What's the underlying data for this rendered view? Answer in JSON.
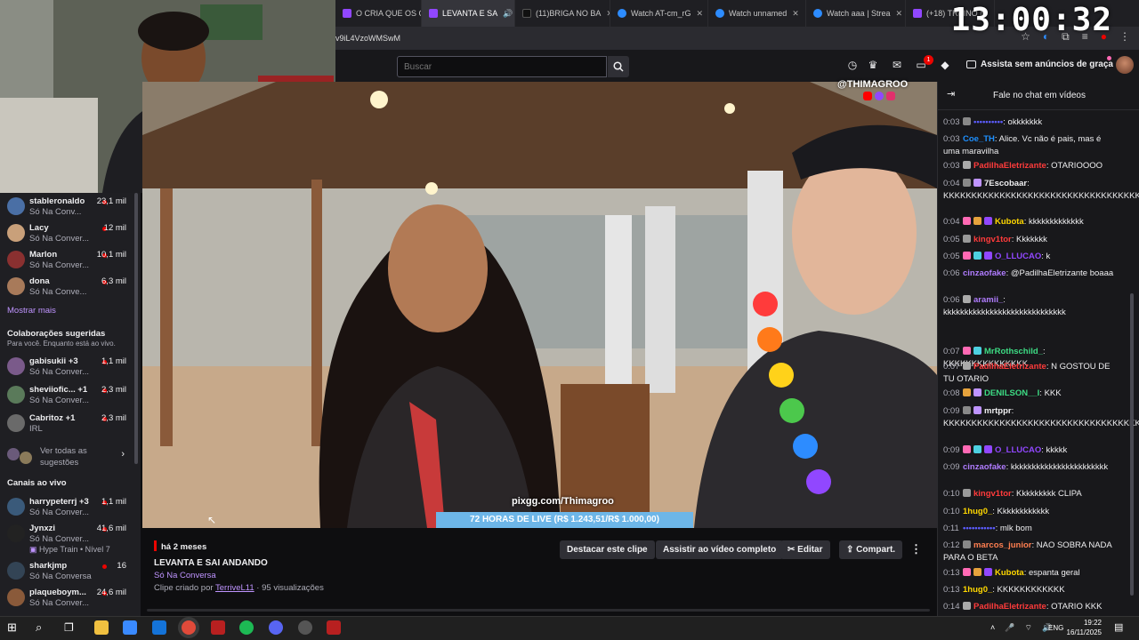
{
  "browser": {
    "tabs": [
      {
        "title": "O CRIA QUE OS C",
        "color": "#9147ff"
      },
      {
        "title": "LEVANTA E SA",
        "color": "#9147ff",
        "active": true
      },
      {
        "title": "(11)BRIGA NO BA",
        "color": "#111111"
      },
      {
        "title": "Watch AT-cm_rG",
        "color": "#2d8cff"
      },
      {
        "title": "Watch unnamed",
        "color": "#2d8cff"
      },
      {
        "title": "Watch aaa | Strea",
        "color": "#2d8cff"
      },
      {
        "title": "(+18) TREINO N",
        "color": "#9147ff"
      }
    ],
    "url_fragment": "v9iL4VzoWMSwM",
    "clock": "13:00:32"
  },
  "topnav": {
    "search_placeholder": "Buscar",
    "notification_count": "1",
    "adfree_label": "Assista sem anúncios de graça"
  },
  "sidebar": {
    "followed": [
      {
        "name": "stableronaldo",
        "sub": "Só Na Conv...",
        "viewers": "23,1 mil",
        "color": "#4a6fa5"
      },
      {
        "name": "Lacy",
        "sub": "Só Na Conver...",
        "viewers": "12 mil",
        "color": "#c9a07a"
      },
      {
        "name": "Marlon",
        "sub": "Só Na Conver...",
        "viewers": "10,1 mil",
        "color": "#8a3030"
      },
      {
        "name": "dona",
        "sub": "Só Na Conve...",
        "viewers": "6,3 mil",
        "color": "#a87a5a"
      }
    ],
    "show_more": "Mostrar mais",
    "collab_title": "Colaborações sugeridas",
    "collab_sub": "Para você. Enquanto está ao vivo.",
    "collabs": [
      {
        "name": "gabisukii +3",
        "sub": "Só Na Conver...",
        "viewers": "1,1 mil",
        "color": "#7a5a8a"
      },
      {
        "name": "sheviiofic... +1",
        "sub": "Só Na Conver...",
        "viewers": "2,3 mil",
        "color": "#5a7a5a"
      },
      {
        "name": "Cabritoz +1",
        "sub": "IRL",
        "viewers": "2,3 mil",
        "color": "#6a6a6a"
      }
    ],
    "see_all": "Ver todas as sugestões",
    "live_title": "Canais ao vivo",
    "live": [
      {
        "name": "harrypeterrj +3",
        "sub": "Só Na Conver...",
        "viewers": "1,1 mil",
        "color": "#3a5a7a"
      },
      {
        "name": "Jynxzi",
        "sub": "Só Na Conver...",
        "viewers": "41,6 mil",
        "color": "#222222"
      },
      {
        "name": "Hype Train • Nível 7",
        "sub": "",
        "viewers": "",
        "color": ""
      },
      {
        "name": "sharkjmp",
        "sub": "Só Na Conversa",
        "viewers": "16",
        "color": "#334455"
      },
      {
        "name": "plaqueboym...",
        "sub": "Só Na Conver...",
        "viewers": "24,6 mil",
        "color": "#8a5a3a"
      }
    ]
  },
  "video": {
    "watermark": "@THIMAGROO",
    "pix": "pixgg.com/Thimagroo",
    "goal_text": "72 HORAS DE LIVE (R$ 1.243,51/R$ 1.000,00)"
  },
  "clip": {
    "ago": "há 2 meses",
    "title": "LEVANTA E SAI ANDANDO",
    "category": "Só Na Conversa",
    "created_prefix": "Clipe criado por",
    "creator": "TerriveL11",
    "views": " · 95 visualizações",
    "buttons": {
      "highlight": "Destacar este clipe",
      "watch_full": "Assistir ao vídeo completo",
      "edit": "Editar",
      "share": "Compart."
    }
  },
  "chat": {
    "title": "Fale no chat em vídeos",
    "messages": [
      {
        "ts": "0:03",
        "user": "••••••••••",
        "color": "#5c5cff",
        "badges": [
          "#888"
        ],
        "text": ": okkkkkkk"
      },
      {
        "ts": "0:03",
        "user": "Coe_TH",
        "color": "#1e90ff",
        "badges": [],
        "text": ": Alice. Vc não é pais, mas é uma maravilha"
      },
      {
        "ts": "0:03",
        "user": "PadilhaEletrizante",
        "color": "#ff3b3b",
        "badges": [
          "#aaa"
        ],
        "text": ": OTARIOOOO"
      },
      {
        "ts": "0:04",
        "user": "7Escobaar",
        "color": "#efeff1",
        "badges": [
          "#888",
          "#bf94ff"
        ],
        "text": ": KKKKKKKKKKKKKKKKKKKKKKKKKKKKKKKKKKKKK"
      },
      {
        "ts": "0:04",
        "user": "Kubota",
        "color": "#ffd700",
        "badges": [
          "#ff69b4",
          "#e6a23c",
          "#9147ff"
        ],
        "text": ": kkkkkkkkkkkkk"
      },
      {
        "ts": "0:05",
        "user": "kingv1tor",
        "color": "#ff3b3b",
        "badges": [
          "#999"
        ],
        "text": ": Kkkkkkk"
      },
      {
        "ts": "0:05",
        "user": "O_LLUCAO",
        "color": "#9147ff",
        "badges": [
          "#ff69b4",
          "#4dd0e1",
          "#9147ff"
        ],
        "text": ": k"
      },
      {
        "ts": "0:06",
        "user": "cinzaofake",
        "color": "#b07cff",
        "badges": [],
        "text": ": @PadilhaEletrizante boaaa"
      },
      {
        "ts": "0:06",
        "user": "aramii_",
        "color": "#b07cff",
        "badges": [
          "#aaa"
        ],
        "text": ": kkkkkkkkkkkkkkkkkkkkkkkkkkkkk"
      },
      {
        "ts": "0:07",
        "user": "MrRothschild_",
        "color": "#3ddc84",
        "badges": [
          "#ff69b4",
          "#4dd0e1"
        ],
        "text": ": KKKKKKKKKKKKKKK"
      },
      {
        "ts": "0:07",
        "user": "PadilhaEletrizante",
        "color": "#ff3b3b",
        "badges": [
          "#aaa"
        ],
        "text": ": N GOSTOU DE TU OTARIO"
      },
      {
        "ts": "0:08",
        "user": "DENILSON__I",
        "color": "#3ddc84",
        "badges": [
          "#e6a23c",
          "#bf94ff"
        ],
        "text": ": KKK"
      },
      {
        "ts": "0:09",
        "user": "mrtppr",
        "color": "#efeff1",
        "badges": [
          "#888",
          "#bf94ff"
        ],
        "text": ": KKKKKKKKKKKKKKKKKKKKKKKKKKKKKKKKKKKKK"
      },
      {
        "ts": "0:09",
        "user": "O_LLUCAO",
        "color": "#9147ff",
        "badges": [
          "#ff69b4",
          "#4dd0e1",
          "#9147ff"
        ],
        "text": ": kkkkk"
      },
      {
        "ts": "0:09",
        "user": "cinzaofake",
        "color": "#b07cff",
        "badges": [],
        "text": ": kkkkkkkkkkkkkkkkkkkkkkk"
      },
      {
        "ts": "0:10",
        "user": "kingv1tor",
        "color": "#ff3b3b",
        "badges": [
          "#999"
        ],
        "text": ": Kkkkkkkkk CLIPA"
      },
      {
        "ts": "0:10",
        "user": "1hug0_",
        "color": "#ffd700",
        "badges": [],
        "text": ": Kkkkkkkkkkkk"
      },
      {
        "ts": "0:11",
        "user": "•••••••••••",
        "color": "#5c5cff",
        "badges": [],
        "text": ": mlk bom"
      },
      {
        "ts": "0:12",
        "user": "marcos_junior",
        "color": "#ff7f50",
        "badges": [
          "#888"
        ],
        "text": ": NAO SOBRA NADA PARA O BETA"
      },
      {
        "ts": "0:13",
        "user": "Kubota",
        "color": "#ffd700",
        "badges": [
          "#ff69b4",
          "#e6a23c",
          "#9147ff"
        ],
        "text": ": espanta geral"
      },
      {
        "ts": "0:13",
        "user": "1hug0_",
        "color": "#ffd700",
        "badges": [],
        "text": ": KKKKKKKKKKKK"
      },
      {
        "ts": "0:14",
        "user": "PadilhaEletrizante",
        "color": "#ff3b3b",
        "badges": [
          "#aaa"
        ],
        "text": ": OTARIO KKK"
      }
    ]
  },
  "taskbar": {
    "lang": "ENG",
    "time": "19:22",
    "date": "16/11/2025"
  }
}
